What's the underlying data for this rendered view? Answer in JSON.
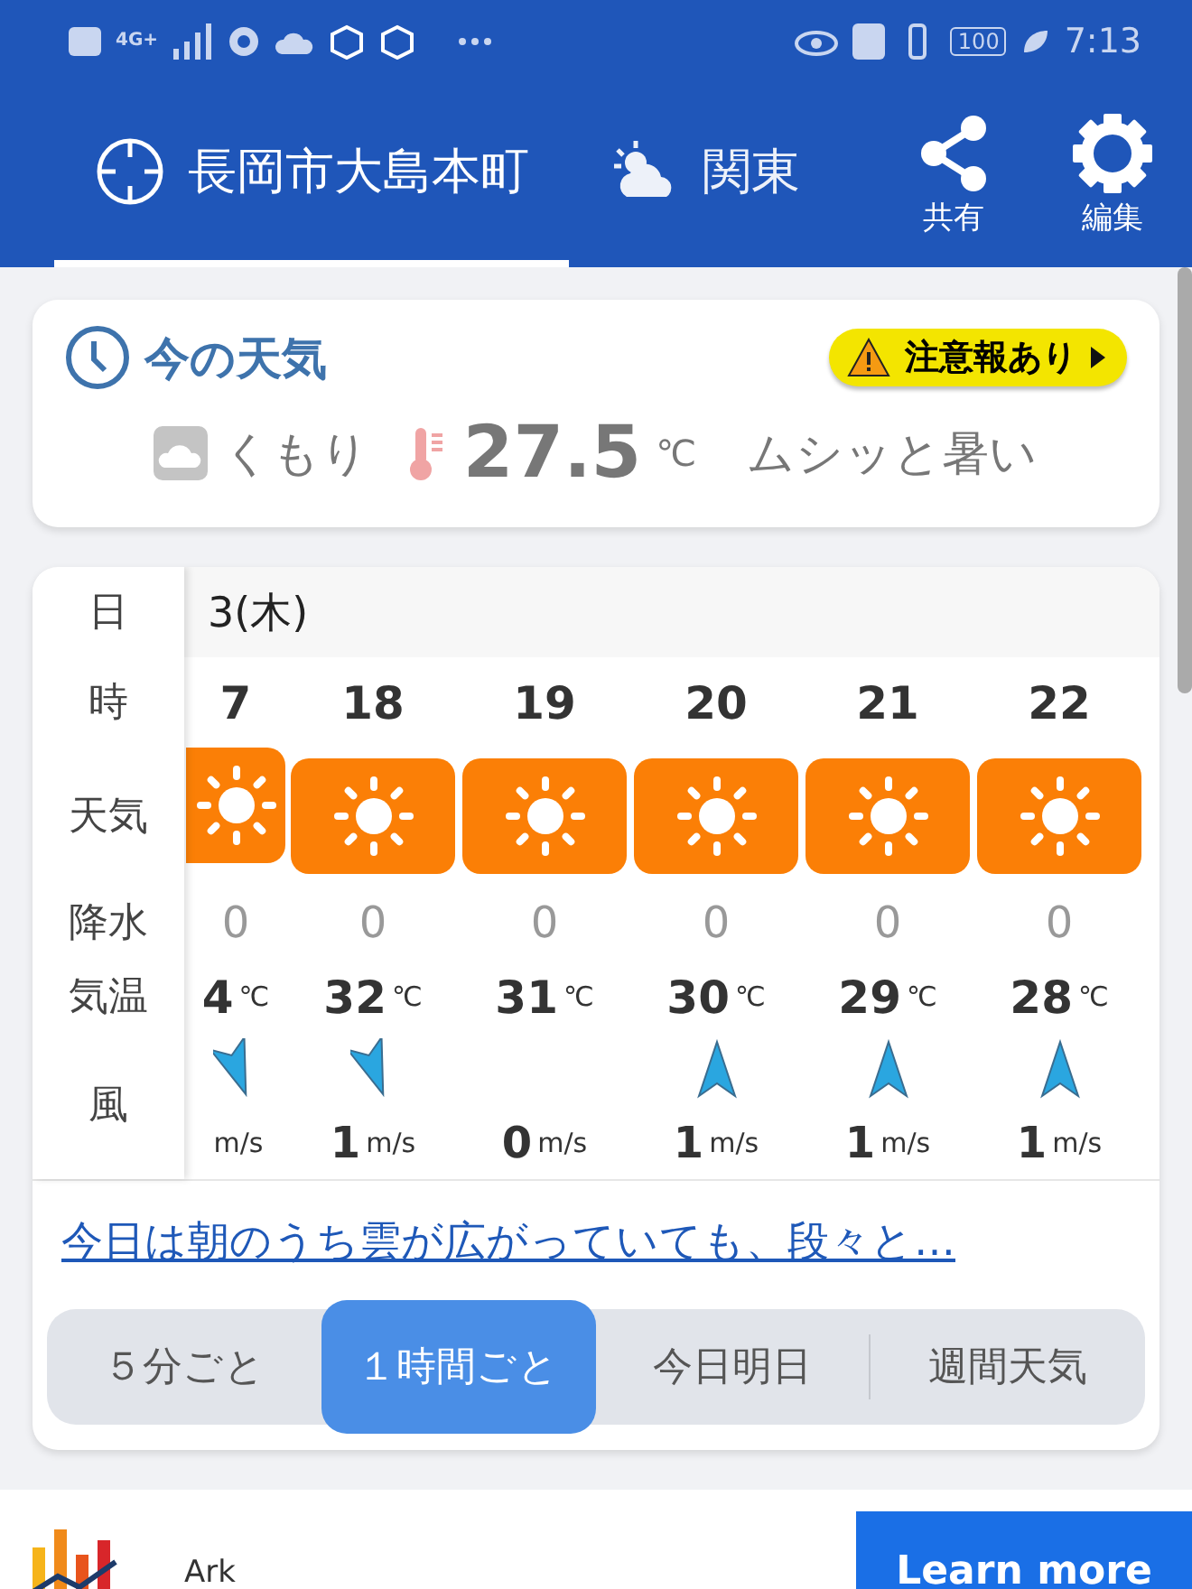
{
  "status_bar": {
    "network": "4G+",
    "battery": "100",
    "time": "7:13"
  },
  "tabs": [
    {
      "label": "長岡市大島本町",
      "kind": "location",
      "selected": true
    },
    {
      "label": "関東",
      "kind": "region",
      "selected": false
    }
  ],
  "actions": [
    {
      "label": "共有",
      "kind": "share"
    },
    {
      "label": "編集",
      "kind": "settings"
    }
  ],
  "current": {
    "title": "今の天気",
    "alert": "注意報あり",
    "condition": "くもり",
    "temperature": "27.5",
    "unit": "℃",
    "feeling": "ムシッと暑い"
  },
  "hourly": {
    "row_labels": [
      "日",
      "時",
      "天気",
      "降水",
      "気温",
      "風"
    ],
    "date": "3(木)",
    "hours": [
      {
        "hour": "7",
        "weather": {
          "kind": "sunny"
        },
        "precip": "0",
        "temp": "4",
        "temp_unit": "℃",
        "wind": {
          "kind": "down"
        },
        "speed_unit": "m/s"
      },
      {
        "hour": "18",
        "weather": {
          "kind": "sunny"
        },
        "precip": "0",
        "temp": "32",
        "temp_unit": "℃",
        "wind": {
          "kind": "down"
        },
        "speed": "1",
        "speed_unit": "m/s"
      },
      {
        "hour": "19",
        "weather": {
          "kind": "sunny"
        },
        "precip": "0",
        "temp": "31",
        "temp_unit": "℃",
        "speed": "0",
        "speed_unit": "m/s"
      },
      {
        "hour": "20",
        "weather": {
          "kind": "sunny"
        },
        "precip": "0",
        "temp": "30",
        "temp_unit": "℃",
        "wind": {
          "kind": "up"
        },
        "speed": "1",
        "speed_unit": "m/s"
      },
      {
        "hour": "21",
        "weather": {
          "kind": "sunny"
        },
        "precip": "0",
        "temp": "29",
        "temp_unit": "℃",
        "wind": {
          "kind": "up"
        },
        "speed": "1",
        "speed_unit": "m/s"
      },
      {
        "hour": "22",
        "weather": {
          "kind": "sunny"
        },
        "precip": "0",
        "temp": "28",
        "temp_unit": "℃",
        "wind": {
          "kind": "up"
        },
        "speed": "1",
        "speed_unit": "m/s"
      }
    ]
  },
  "summary_link": "今日は朝のうち雲が広がっていても、段々と…",
  "views": [
    {
      "label": "５分ごと",
      "selected": false
    },
    {
      "label": "１時間ごと",
      "selected": true
    },
    {
      "label": "今日明日",
      "selected": false
    },
    {
      "label": "週間天気",
      "selected": false
    }
  ],
  "ad": {
    "name": "Ark",
    "button": "Learn more"
  }
}
